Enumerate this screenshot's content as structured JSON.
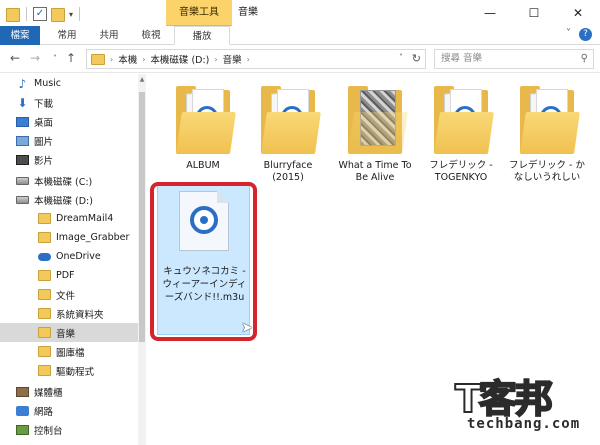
{
  "window": {
    "context_tab": "音樂工具",
    "title": "音樂",
    "minimize": "—",
    "maximize": "☐",
    "close": "✕"
  },
  "ribbon": {
    "tabs": [
      {
        "label": "檔案"
      },
      {
        "label": "常用"
      },
      {
        "label": "共用"
      },
      {
        "label": "檢視"
      },
      {
        "label": "播放"
      }
    ]
  },
  "address": {
    "path": [
      "本機",
      "本機磁碟 (D:)",
      "音樂"
    ],
    "search_placeholder": "搜尋 音樂"
  },
  "sidebar": {
    "items": [
      {
        "label": "Music",
        "icon": "music-icon"
      },
      {
        "label": "下載",
        "icon": "download-icon"
      },
      {
        "label": "桌面",
        "icon": "desktop-icon"
      },
      {
        "label": "圖片",
        "icon": "pictures-icon"
      },
      {
        "label": "影片",
        "icon": "videos-icon"
      },
      {
        "label": "本機磁碟 (C:)",
        "icon": "drive-icon"
      },
      {
        "label": "本機磁碟 (D:)",
        "icon": "drive-icon"
      },
      {
        "label": "DreamMail4",
        "icon": "folder-icon"
      },
      {
        "label": "Image_Grabber",
        "icon": "folder-icon"
      },
      {
        "label": "OneDrive",
        "icon": "onedrive-icon"
      },
      {
        "label": "PDF",
        "icon": "folder-icon"
      },
      {
        "label": "文件",
        "icon": "folder-icon"
      },
      {
        "label": "系統資料夾",
        "icon": "folder-icon"
      },
      {
        "label": "音樂",
        "icon": "folder-icon",
        "selected": true
      },
      {
        "label": "圖庫檔",
        "icon": "folder-icon"
      },
      {
        "label": "驅動程式",
        "icon": "folder-icon"
      },
      {
        "label": "媒體櫃",
        "icon": "library-icon"
      },
      {
        "label": "網路",
        "icon": "network-icon"
      },
      {
        "label": "控制台",
        "icon": "control-panel-icon"
      }
    ]
  },
  "content": {
    "folders": [
      {
        "label": "ALBUM",
        "thumb": "disc"
      },
      {
        "label": "Blurryface (2015)",
        "thumb": "disc"
      },
      {
        "label": "What a Time To Be Alive",
        "thumb": "photo"
      },
      {
        "label": "フレデリック - TOGENKYO",
        "thumb": "disc"
      },
      {
        "label": "フレデリック - かなしいうれしい",
        "thumb": "disc"
      }
    ],
    "selected_file": {
      "label": "キュウソネコカミ - ウィーアーインディーズバンド!!.m3u"
    }
  },
  "watermark": {
    "main": "T客邦",
    "sub": "techbang.com"
  }
}
